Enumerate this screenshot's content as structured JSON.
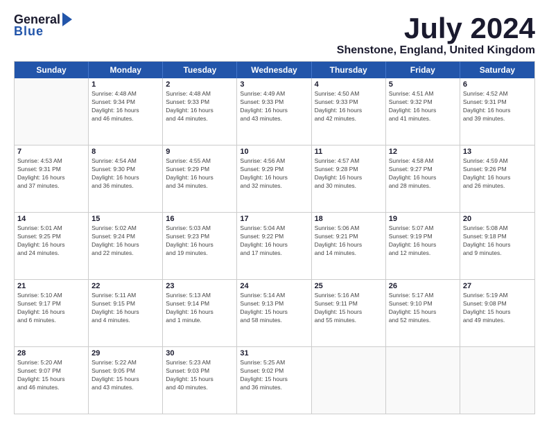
{
  "logo": {
    "general": "General",
    "blue": "Blue"
  },
  "title": {
    "month": "July 2024",
    "location": "Shenstone, England, United Kingdom"
  },
  "calendar": {
    "headers": [
      "Sunday",
      "Monday",
      "Tuesday",
      "Wednesday",
      "Thursday",
      "Friday",
      "Saturday"
    ],
    "rows": [
      [
        {
          "day": "",
          "info": ""
        },
        {
          "day": "1",
          "info": "Sunrise: 4:48 AM\nSunset: 9:34 PM\nDaylight: 16 hours\nand 46 minutes."
        },
        {
          "day": "2",
          "info": "Sunrise: 4:48 AM\nSunset: 9:33 PM\nDaylight: 16 hours\nand 44 minutes."
        },
        {
          "day": "3",
          "info": "Sunrise: 4:49 AM\nSunset: 9:33 PM\nDaylight: 16 hours\nand 43 minutes."
        },
        {
          "day": "4",
          "info": "Sunrise: 4:50 AM\nSunset: 9:33 PM\nDaylight: 16 hours\nand 42 minutes."
        },
        {
          "day": "5",
          "info": "Sunrise: 4:51 AM\nSunset: 9:32 PM\nDaylight: 16 hours\nand 41 minutes."
        },
        {
          "day": "6",
          "info": "Sunrise: 4:52 AM\nSunset: 9:31 PM\nDaylight: 16 hours\nand 39 minutes."
        }
      ],
      [
        {
          "day": "7",
          "info": "Sunrise: 4:53 AM\nSunset: 9:31 PM\nDaylight: 16 hours\nand 37 minutes."
        },
        {
          "day": "8",
          "info": "Sunrise: 4:54 AM\nSunset: 9:30 PM\nDaylight: 16 hours\nand 36 minutes."
        },
        {
          "day": "9",
          "info": "Sunrise: 4:55 AM\nSunset: 9:29 PM\nDaylight: 16 hours\nand 34 minutes."
        },
        {
          "day": "10",
          "info": "Sunrise: 4:56 AM\nSunset: 9:29 PM\nDaylight: 16 hours\nand 32 minutes."
        },
        {
          "day": "11",
          "info": "Sunrise: 4:57 AM\nSunset: 9:28 PM\nDaylight: 16 hours\nand 30 minutes."
        },
        {
          "day": "12",
          "info": "Sunrise: 4:58 AM\nSunset: 9:27 PM\nDaylight: 16 hours\nand 28 minutes."
        },
        {
          "day": "13",
          "info": "Sunrise: 4:59 AM\nSunset: 9:26 PM\nDaylight: 16 hours\nand 26 minutes."
        }
      ],
      [
        {
          "day": "14",
          "info": "Sunrise: 5:01 AM\nSunset: 9:25 PM\nDaylight: 16 hours\nand 24 minutes."
        },
        {
          "day": "15",
          "info": "Sunrise: 5:02 AM\nSunset: 9:24 PM\nDaylight: 16 hours\nand 22 minutes."
        },
        {
          "day": "16",
          "info": "Sunrise: 5:03 AM\nSunset: 9:23 PM\nDaylight: 16 hours\nand 19 minutes."
        },
        {
          "day": "17",
          "info": "Sunrise: 5:04 AM\nSunset: 9:22 PM\nDaylight: 16 hours\nand 17 minutes."
        },
        {
          "day": "18",
          "info": "Sunrise: 5:06 AM\nSunset: 9:21 PM\nDaylight: 16 hours\nand 14 minutes."
        },
        {
          "day": "19",
          "info": "Sunrise: 5:07 AM\nSunset: 9:19 PM\nDaylight: 16 hours\nand 12 minutes."
        },
        {
          "day": "20",
          "info": "Sunrise: 5:08 AM\nSunset: 9:18 PM\nDaylight: 16 hours\nand 9 minutes."
        }
      ],
      [
        {
          "day": "21",
          "info": "Sunrise: 5:10 AM\nSunset: 9:17 PM\nDaylight: 16 hours\nand 6 minutes."
        },
        {
          "day": "22",
          "info": "Sunrise: 5:11 AM\nSunset: 9:15 PM\nDaylight: 16 hours\nand 4 minutes."
        },
        {
          "day": "23",
          "info": "Sunrise: 5:13 AM\nSunset: 9:14 PM\nDaylight: 16 hours\nand 1 minute."
        },
        {
          "day": "24",
          "info": "Sunrise: 5:14 AM\nSunset: 9:13 PM\nDaylight: 15 hours\nand 58 minutes."
        },
        {
          "day": "25",
          "info": "Sunrise: 5:16 AM\nSunset: 9:11 PM\nDaylight: 15 hours\nand 55 minutes."
        },
        {
          "day": "26",
          "info": "Sunrise: 5:17 AM\nSunset: 9:10 PM\nDaylight: 15 hours\nand 52 minutes."
        },
        {
          "day": "27",
          "info": "Sunrise: 5:19 AM\nSunset: 9:08 PM\nDaylight: 15 hours\nand 49 minutes."
        }
      ],
      [
        {
          "day": "28",
          "info": "Sunrise: 5:20 AM\nSunset: 9:07 PM\nDaylight: 15 hours\nand 46 minutes."
        },
        {
          "day": "29",
          "info": "Sunrise: 5:22 AM\nSunset: 9:05 PM\nDaylight: 15 hours\nand 43 minutes."
        },
        {
          "day": "30",
          "info": "Sunrise: 5:23 AM\nSunset: 9:03 PM\nDaylight: 15 hours\nand 40 minutes."
        },
        {
          "day": "31",
          "info": "Sunrise: 5:25 AM\nSunset: 9:02 PM\nDaylight: 15 hours\nand 36 minutes."
        },
        {
          "day": "",
          "info": ""
        },
        {
          "day": "",
          "info": ""
        },
        {
          "day": "",
          "info": ""
        }
      ]
    ]
  }
}
